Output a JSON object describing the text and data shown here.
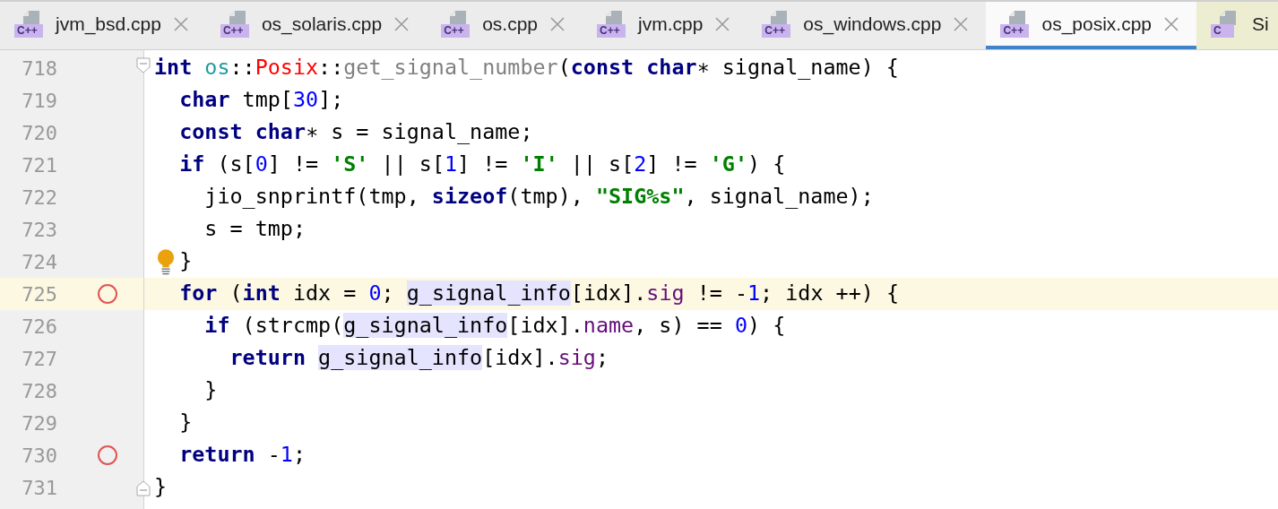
{
  "tabs": [
    {
      "label": "jvm_bsd.cpp",
      "icon_label": "C++",
      "kind": "cpp",
      "selected": false,
      "closable": true
    },
    {
      "label": "os_solaris.cpp",
      "icon_label": "C++",
      "kind": "cpp",
      "selected": false,
      "closable": true
    },
    {
      "label": "os.cpp",
      "icon_label": "C++",
      "kind": "cpp",
      "selected": false,
      "closable": true
    },
    {
      "label": "jvm.cpp",
      "icon_label": "C++",
      "kind": "cpp",
      "selected": false,
      "closable": true
    },
    {
      "label": "os_windows.cpp",
      "icon_label": "C++",
      "kind": "cpp",
      "selected": false,
      "closable": true
    },
    {
      "label": "os_posix.cpp",
      "icon_label": "C++",
      "kind": "cpp",
      "selected": true,
      "closable": true
    },
    {
      "label": "Si",
      "icon_label": "C",
      "kind": "c",
      "selected": false,
      "closable": false
    }
  ],
  "editor": {
    "lines": [
      {
        "number": "718",
        "breakpoint": false,
        "current": false,
        "bulb": false,
        "fold_start": true,
        "fold_end": false,
        "tokens": [
          {
            "t": "int ",
            "kind": "kw"
          },
          {
            "t": "os",
            "kind": "ns"
          },
          {
            "t": "::",
            "kind": "plain"
          },
          {
            "t": "Posix",
            "kind": "cls"
          },
          {
            "t": "::",
            "kind": "plain"
          },
          {
            "t": "get_signal_number",
            "kind": "fn"
          },
          {
            "t": "(",
            "kind": "plain"
          },
          {
            "t": "const char",
            "kind": "kw"
          },
          {
            "t": "∗ signal_name) {",
            "kind": "plain"
          }
        ]
      },
      {
        "number": "719",
        "breakpoint": false,
        "current": false,
        "bulb": false,
        "tokens": [
          {
            "t": "  char",
            "kind": "kw"
          },
          {
            "t": " tmp[",
            "kind": "plain"
          },
          {
            "t": "30",
            "kind": "num"
          },
          {
            "t": "];",
            "kind": "plain"
          }
        ]
      },
      {
        "number": "720",
        "breakpoint": false,
        "current": false,
        "bulb": false,
        "tokens": [
          {
            "t": "  const char",
            "kind": "kw"
          },
          {
            "t": "∗ s = signal_name;",
            "kind": "plain"
          }
        ]
      },
      {
        "number": "721",
        "breakpoint": false,
        "current": false,
        "bulb": false,
        "tokens": [
          {
            "t": "  if",
            "kind": "kw"
          },
          {
            "t": " (s[",
            "kind": "plain"
          },
          {
            "t": "0",
            "kind": "num"
          },
          {
            "t": "] != ",
            "kind": "plain"
          },
          {
            "t": "'S'",
            "kind": "str"
          },
          {
            "t": " || s[",
            "kind": "plain"
          },
          {
            "t": "1",
            "kind": "num"
          },
          {
            "t": "] != ",
            "kind": "plain"
          },
          {
            "t": "'I'",
            "kind": "str"
          },
          {
            "t": " || s[",
            "kind": "plain"
          },
          {
            "t": "2",
            "kind": "num"
          },
          {
            "t": "] != ",
            "kind": "plain"
          },
          {
            "t": "'G'",
            "kind": "str"
          },
          {
            "t": ") {",
            "kind": "plain"
          }
        ]
      },
      {
        "number": "722",
        "breakpoint": false,
        "current": false,
        "bulb": false,
        "tokens": [
          {
            "t": "    jio_snprintf(tmp, ",
            "kind": "plain"
          },
          {
            "t": "sizeof",
            "kind": "kw"
          },
          {
            "t": "(tmp), ",
            "kind": "plain"
          },
          {
            "t": "\"SIG%s\"",
            "kind": "str"
          },
          {
            "t": ", signal_name);",
            "kind": "plain"
          }
        ]
      },
      {
        "number": "723",
        "breakpoint": false,
        "current": false,
        "bulb": false,
        "tokens": [
          {
            "t": "    s = tmp;",
            "kind": "plain"
          }
        ]
      },
      {
        "number": "724",
        "breakpoint": false,
        "current": false,
        "bulb": true,
        "tokens": [
          {
            "t": "  }",
            "kind": "plain"
          }
        ]
      },
      {
        "number": "725",
        "breakpoint": true,
        "current": true,
        "bulb": false,
        "tokens": [
          {
            "t": "  for",
            "kind": "kw"
          },
          {
            "t": " (",
            "kind": "plain"
          },
          {
            "t": "int",
            "kind": "kw"
          },
          {
            "t": " idx = ",
            "kind": "plain"
          },
          {
            "t": "0",
            "kind": "num"
          },
          {
            "t": "; ",
            "kind": "plain"
          },
          {
            "t": "g_signal_info",
            "kind": "hl"
          },
          {
            "t": "[idx].",
            "kind": "plain"
          },
          {
            "t": "sig",
            "kind": "field"
          },
          {
            "t": " != -",
            "kind": "plain"
          },
          {
            "t": "1",
            "kind": "num"
          },
          {
            "t": "; idx ++) {",
            "kind": "plain"
          }
        ]
      },
      {
        "number": "726",
        "breakpoint": false,
        "current": false,
        "bulb": false,
        "tokens": [
          {
            "t": "    if",
            "kind": "kw"
          },
          {
            "t": " (strcmp(",
            "kind": "plain"
          },
          {
            "t": "g_signal_info",
            "kind": "hl"
          },
          {
            "t": "[idx].",
            "kind": "plain"
          },
          {
            "t": "name",
            "kind": "field"
          },
          {
            "t": ", s) == ",
            "kind": "plain"
          },
          {
            "t": "0",
            "kind": "num"
          },
          {
            "t": ") {",
            "kind": "plain"
          }
        ]
      },
      {
        "number": "727",
        "breakpoint": false,
        "current": false,
        "bulb": false,
        "tokens": [
          {
            "t": "      return ",
            "kind": "kw"
          },
          {
            "t": "g_signal_info",
            "kind": "hl"
          },
          {
            "t": "[idx].",
            "kind": "plain"
          },
          {
            "t": "sig",
            "kind": "field"
          },
          {
            "t": ";",
            "kind": "plain"
          }
        ]
      },
      {
        "number": "728",
        "breakpoint": false,
        "current": false,
        "bulb": false,
        "tokens": [
          {
            "t": "    }",
            "kind": "plain"
          }
        ]
      },
      {
        "number": "729",
        "breakpoint": false,
        "current": false,
        "bulb": false,
        "tokens": [
          {
            "t": "  }",
            "kind": "plain"
          }
        ]
      },
      {
        "number": "730",
        "breakpoint": true,
        "current": false,
        "bulb": false,
        "tokens": [
          {
            "t": "  return",
            "kind": "kw"
          },
          {
            "t": " -",
            "kind": "plain"
          },
          {
            "t": "1",
            "kind": "num"
          },
          {
            "t": ";",
            "kind": "plain"
          }
        ]
      },
      {
        "number": "731",
        "breakpoint": false,
        "current": false,
        "bulb": false,
        "fold_start": false,
        "fold_end": true,
        "tokens": [
          {
            "t": "}",
            "kind": "plain"
          }
        ]
      }
    ]
  }
}
